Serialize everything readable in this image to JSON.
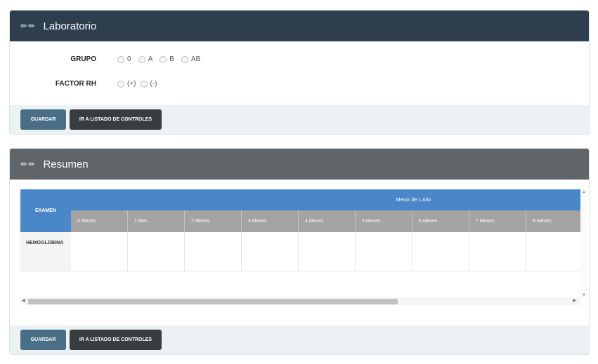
{
  "lab": {
    "title": "Laboratorio",
    "grupo": {
      "label": "GRUPO",
      "options": [
        "0",
        "A",
        "B",
        "AB"
      ]
    },
    "factor": {
      "label": "FACTOR RH",
      "options": [
        "(+)",
        "(-)"
      ]
    },
    "buttons": {
      "save": "GUARDAR",
      "list": "IR A LISTADO DE CONTROLES"
    }
  },
  "summary": {
    "title": "Resumen",
    "table": {
      "examen_header": "EXAMEN",
      "group_header": "Menor de 1 Año",
      "months": [
        "0 Meses",
        "1 Mes",
        "2 Meses",
        "3 Meses",
        "4 Meses",
        "5 Meses",
        "6 Meses",
        "7 Meses",
        "8 Meses"
      ],
      "rows": [
        "HEMOGLOBINA"
      ]
    },
    "buttons": {
      "save": "GUARDAR",
      "list": "IR A LISTADO DE CONTROLES"
    }
  },
  "icons": {
    "pin": "pin-icon",
    "scroll_up": "▲",
    "scroll_down": "▼",
    "scroll_left": "◀",
    "scroll_right": "▶"
  },
  "colors": {
    "lab_header": "#2e3e4f",
    "summary_header": "#5f6568",
    "table_header": "#4a87c9",
    "month_header": "#a3a3a3",
    "save_button": "#4a6e86",
    "list_button": "#3a3d3f"
  }
}
